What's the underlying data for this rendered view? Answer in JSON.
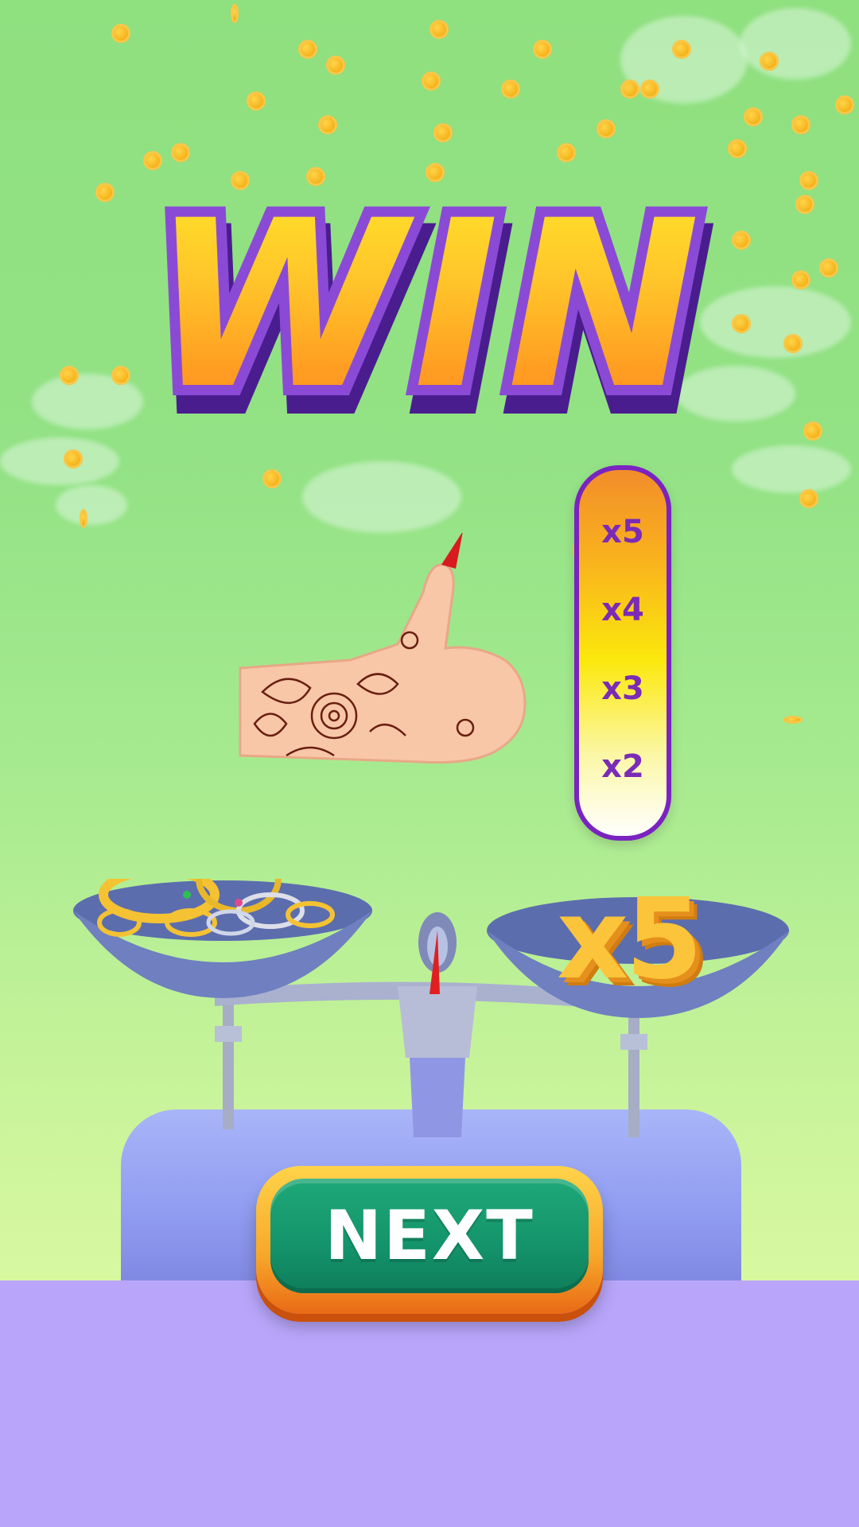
{
  "title": {
    "text": "WIN"
  },
  "multiplier_meter": {
    "labels": [
      "x5",
      "x4",
      "x3",
      "x2"
    ]
  },
  "scale": {
    "right_pan_multiplier": "x5"
  },
  "next_button": {
    "label": "NEXT"
  },
  "colors": {
    "sky": "#8fe07f",
    "floor": "#b9a6fb",
    "title_fill_top": "#ffe42a",
    "title_fill_bottom": "#ff8a1e",
    "title_outline": "#8a4ad6",
    "meter_border": "#7a23c0",
    "meter_text": "#7b2bb6",
    "button_green": "#14936a",
    "button_frame": "#f7a82a"
  },
  "icons": [
    "thumbs-up-hand-icon",
    "coin-icon",
    "balance-scale-icon",
    "jewelry-pile-icon"
  ]
}
